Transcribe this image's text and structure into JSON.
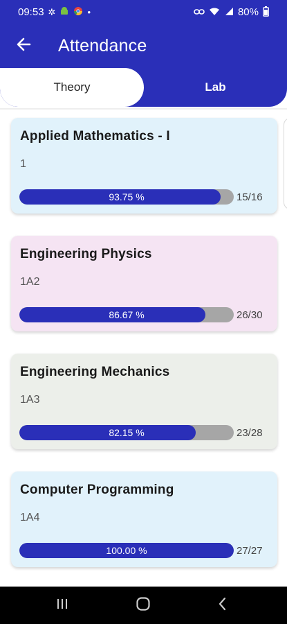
{
  "status_bar": {
    "time": "09:53",
    "battery": "80%",
    "icons_left": [
      "gear-icon",
      "android-icon",
      "chrome-icon",
      "dot-icon"
    ],
    "icons_right": [
      "link-icon",
      "wifi-icon",
      "signal-icon",
      "battery-icon"
    ]
  },
  "app_bar": {
    "title": "Attendance",
    "back_icon": "arrow-left-icon"
  },
  "tabs": [
    {
      "label": "Theory",
      "selected": true
    },
    {
      "label": "Lab",
      "selected": false
    }
  ],
  "subjects": [
    {
      "title": "Applied Mathematics - I",
      "code": "1",
      "percent_label": "93.75 %",
      "fraction": 0.9375,
      "count": "15/16",
      "bg": "#E1F2FB"
    },
    {
      "title": "Engineering Physics",
      "code": "1A2",
      "percent_label": "86.67 %",
      "fraction": 0.8667,
      "count": "26/30",
      "bg": "#F5E4F3"
    },
    {
      "title": "Engineering Mechanics",
      "code": "1A3",
      "percent_label": "82.15 %",
      "fraction": 0.8215,
      "count": "23/28",
      "bg": "#ECEFEA"
    },
    {
      "title": "Computer Programming",
      "code": "1A4",
      "percent_label": "100.00 %",
      "fraction": 1.0,
      "count": "27/27",
      "bg": "#E1F2FB"
    }
  ],
  "colors": {
    "primary": "#2A2FB8",
    "track": "#A6A6A6"
  },
  "nav_bar": {
    "buttons": [
      "recent-apps-icon",
      "home-icon",
      "back-icon"
    ]
  }
}
